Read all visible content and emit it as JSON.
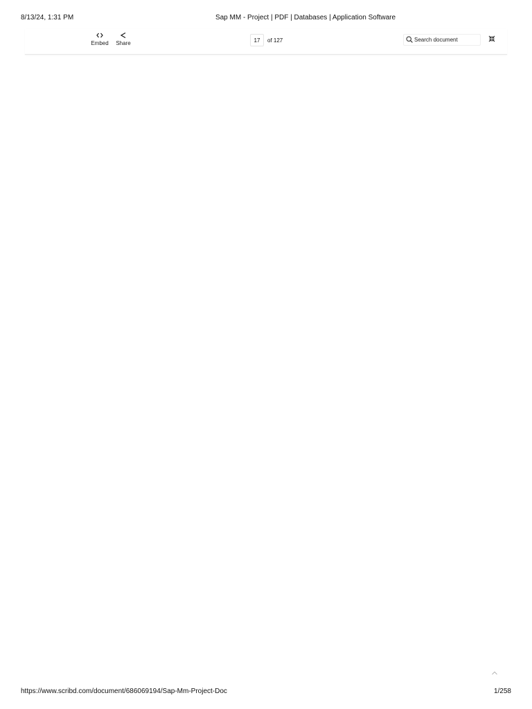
{
  "print_header": {
    "date_time": "8/13/24, 1:31 PM",
    "title": "Sap MM - Project | PDF | Databases | Application Software"
  },
  "toolbar": {
    "embed": {
      "label": "Embed",
      "icon": "code-brackets-icon"
    },
    "share": {
      "label": "Share",
      "icon": "share-icon"
    },
    "pager": {
      "current_page": "17",
      "total_label": "of 127"
    },
    "search": {
      "placeholder": "Search document",
      "icon": "search-icon"
    },
    "collapse": {
      "icon": "collapse-arrows-icon"
    }
  },
  "scroll_top": {
    "icon": "chevron-up-icon"
  },
  "print_footer": {
    "url": "https://www.scribd.com/document/686069194/Sap-Mm-Project-Doc",
    "page_indicator": "1/258"
  }
}
